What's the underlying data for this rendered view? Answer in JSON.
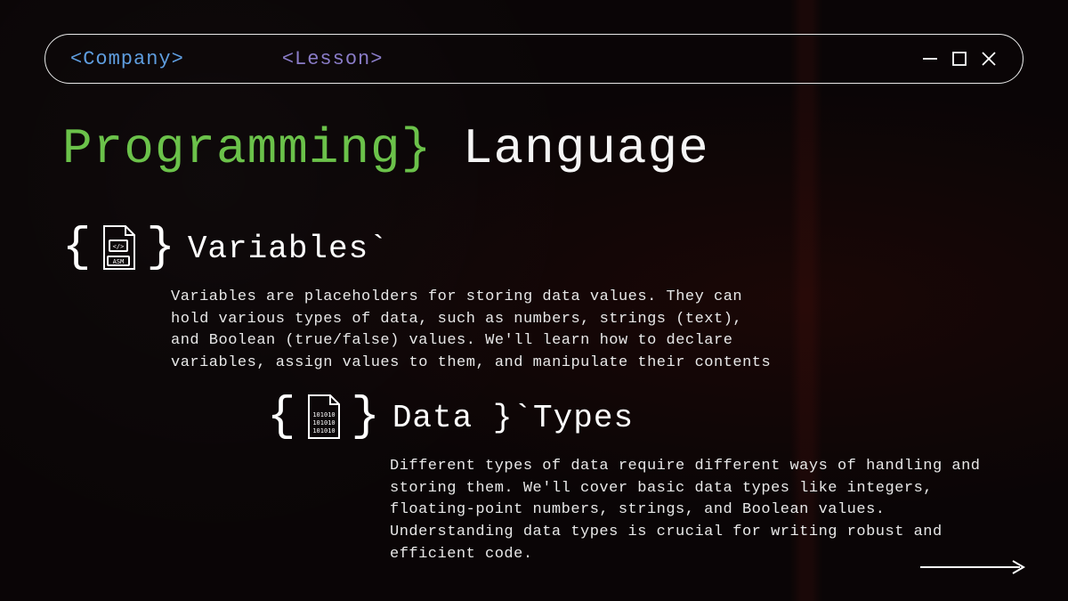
{
  "header": {
    "company": "<Company>",
    "lesson": "<Lesson>"
  },
  "title": {
    "part1": "Programming}",
    "part2": "Language"
  },
  "sections": [
    {
      "icon": "asm-file-icon",
      "heading": "Variables`",
      "body": "Variables are placeholders for storing data values. They can hold various types of data, such as numbers, strings (text), and Boolean (true/false) values. We'll learn how to declare variables, assign values to them, and manipulate their contents"
    },
    {
      "icon": "binary-file-icon",
      "heading": "Data }`Types",
      "body": "Different types of data require different ways of handling and storing them. We'll cover basic data types like integers, floating-point numbers, strings, and Boolean values. Understanding data types is crucial for writing robust and efficient code."
    }
  ],
  "colors": {
    "accent_green": "#6bc24a",
    "accent_blue": "#5f9ee0",
    "accent_purple": "#8a7cc8"
  }
}
